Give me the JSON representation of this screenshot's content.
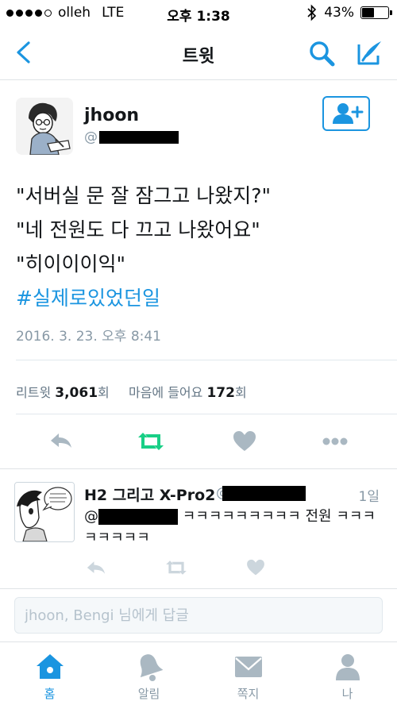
{
  "status_bar": {
    "carrier": "olleh",
    "network": "LTE",
    "time": "오후 1:38",
    "battery_text": "43%",
    "battery_level": 0.43
  },
  "nav": {
    "title": "트윗",
    "back_icon": "chevron-left-icon",
    "search_icon": "search-icon",
    "compose_icon": "compose-icon"
  },
  "tweet": {
    "author_name": "jhoon",
    "author_handle_prefix": "@",
    "text_lines": [
      "\"서버실 문 잘 잠그고 나왔지?\"",
      "\"네 전원도 다 끄고 나왔어요\"",
      "\"히이이이익\""
    ],
    "hashtag": "#실제로있었던일",
    "timestamp": "2016. 3. 23. 오후 8:41",
    "retweets_label": "리트윗",
    "retweets_count": "3,061",
    "retweets_unit": "회",
    "likes_label": "마음에 들어요",
    "likes_count": "172",
    "likes_unit": "회"
  },
  "reply_tweet": {
    "name": "H2 그리고 X-Pro2",
    "handle_prefix": "@j",
    "time": "1일",
    "text_prefix": "@",
    "text_body": " ㅋㅋㅋㅋㅋㅋㅋㅋㅋ 전원 ㅋㅋㅋㅋㅋㅋㅋㅋ"
  },
  "reply_input": {
    "placeholder": "jhoon, Bengi 님에게 답글"
  },
  "tab_bar": {
    "items": [
      {
        "label": "홈",
        "icon": "home-icon",
        "active": true
      },
      {
        "label": "알림",
        "icon": "bell-icon",
        "active": false
      },
      {
        "label": "쪽지",
        "icon": "envelope-icon",
        "active": false
      },
      {
        "label": "나",
        "icon": "person-icon",
        "active": false
      }
    ]
  },
  "colors": {
    "accent": "#1b95e0",
    "retweet_green": "#19cf86",
    "muted": "#8899a6",
    "icon_gray": "#aab8c2"
  }
}
